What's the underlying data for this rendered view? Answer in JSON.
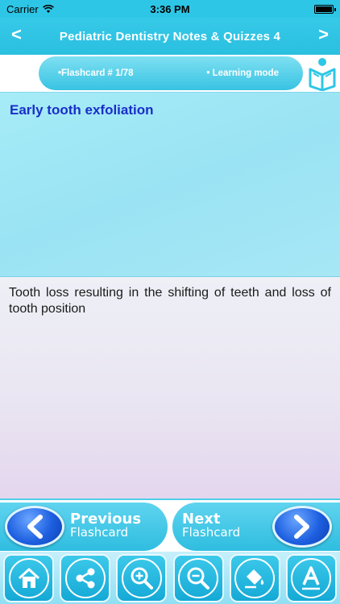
{
  "status": {
    "carrier": "Carrier",
    "time": "3:36 PM"
  },
  "nav": {
    "title": "Pediatric Dentistry Notes & Quizzes 4",
    "back": "<",
    "forward": ">"
  },
  "info": {
    "flashcard": "•Flashcard #  1/78",
    "mode": "• Learning mode",
    "mode_icon": "book-reader-icon"
  },
  "card": {
    "term": "Early tooth exfoliation",
    "definition": "Tooth loss resulting in the shifting of teeth and loss of tooth position"
  },
  "pager": {
    "prev": {
      "main": "Previous",
      "sub": "Flashcard"
    },
    "next": {
      "main": "Next",
      "sub": "Flashcard"
    }
  },
  "toolbar": {
    "items": [
      "home-icon",
      "share-icon",
      "zoom-in-icon",
      "zoom-out-icon",
      "paint-bucket-icon",
      "font-icon"
    ]
  },
  "colors": {
    "accent": "#2ec6e6",
    "term": "#1a2ec9",
    "arrow_circle": "#1d5fe0"
  }
}
